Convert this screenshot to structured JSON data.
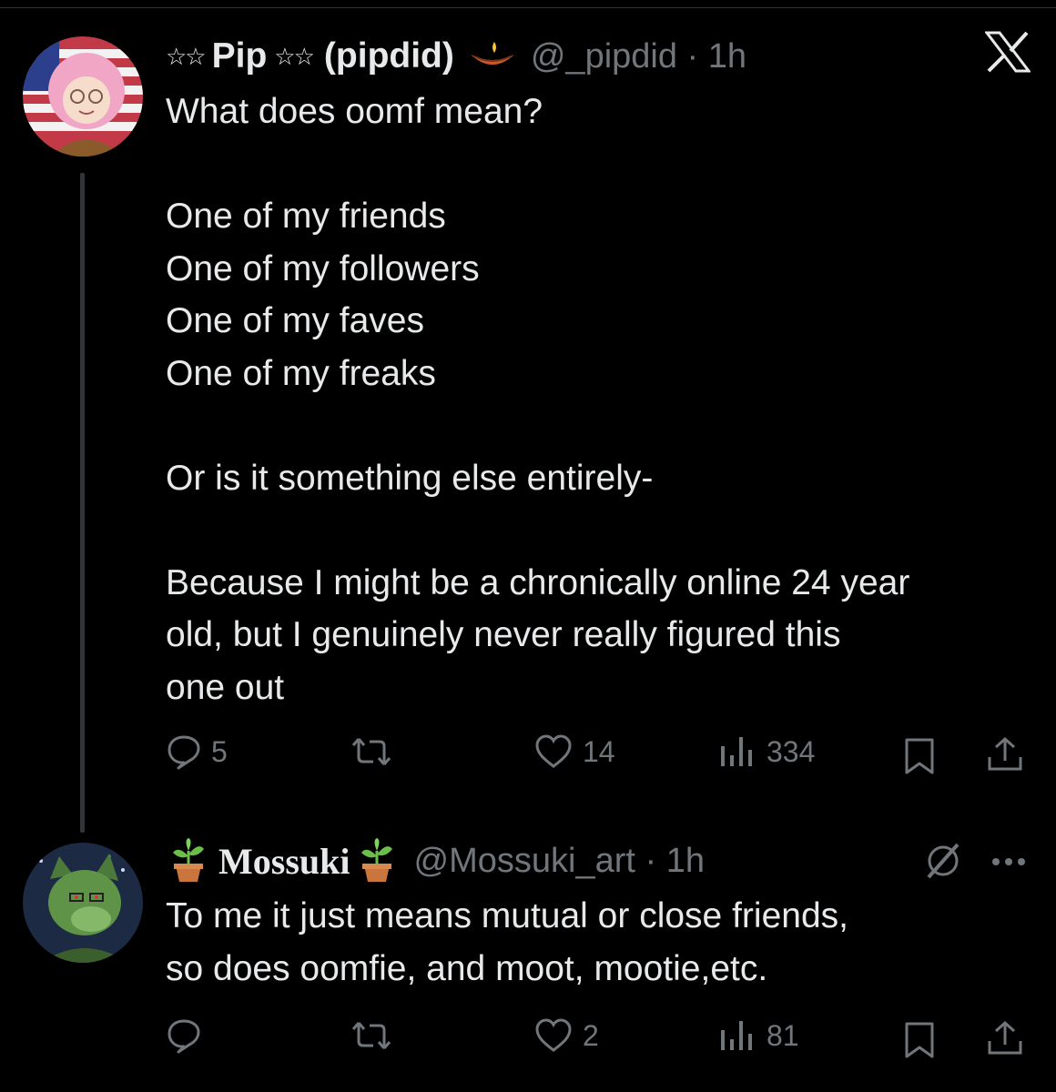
{
  "post": {
    "name_stars_left": "☆☆",
    "name": "Pip",
    "name_stars_right": "☆☆",
    "name_suffix": "(pipdid)",
    "name_emoji": "🪔",
    "handle_time": "@_pipdid · 1h",
    "platform_icon": "x-logo-icon",
    "text": "What does oomf mean?\n\nOne of my friends\nOne of my followers\nOne of my faves\nOne of my freaks\n\nOr is it something else entirely-\n\nBecause I might be a chronically online 24 year\nold, but I genuinely never really figured this\none out",
    "replies": "5",
    "likes": "14",
    "views": "334"
  },
  "reply": {
    "name_emoji_left": "🪴",
    "name": "Mossuki",
    "name_emoji_right": "🪴",
    "handle_time": "@Mossuki_art · 1h",
    "text": "To me it just means mutual or close friends,\nso does oomfie, and moot, mootie,etc.",
    "replies": "",
    "likes": "2",
    "views": "81"
  },
  "colors": {
    "background": "#000000",
    "text": "#e7e9ea",
    "muted": "#71767b",
    "thread_line": "#333639"
  }
}
